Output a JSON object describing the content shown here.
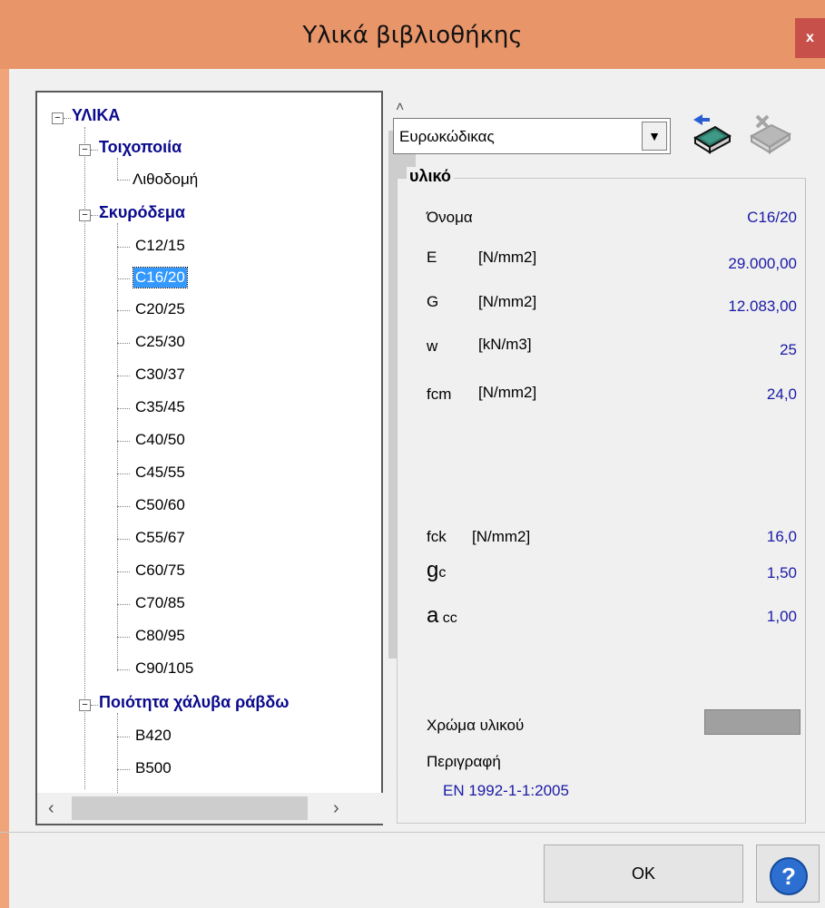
{
  "window": {
    "title": "Υλικά βιβλιοθήκης",
    "close_label": "x"
  },
  "tree": {
    "root": "ΥΛΙΚΑ",
    "groups": [
      {
        "label": "Τοιχοποιία",
        "items": [
          "Λιθοδομή"
        ]
      },
      {
        "label": "Σκυρόδεμα",
        "items": [
          "C12/15",
          "C16/20",
          "C20/25",
          "C25/30",
          "C30/37",
          "C35/45",
          "C40/50",
          "C45/55",
          "C50/60",
          "C55/67",
          "C60/75",
          "C70/85",
          "C80/95",
          "C90/105"
        ]
      },
      {
        "label": "Ποιότητα χάλυβα ράβδω",
        "items": [
          "B420",
          "B500"
        ]
      }
    ],
    "selected": "C16/20"
  },
  "standard": {
    "selected": "Ευρωκώδικας"
  },
  "material": {
    "group_title": "υλικό",
    "name_label": "Όνομα",
    "name_value": "C16/20",
    "E_label": "E",
    "E_unit": "[N/mm2]",
    "E_value": "29.000,00",
    "G_label": "G",
    "G_unit": "[N/mm2]",
    "G_value": "12.083,00",
    "w_label": "w",
    "w_unit": "[kN/m3]",
    "w_value": "25",
    "fcm_label": "fcm",
    "fcm_unit": "[N/mm2]",
    "fcm_value": "24,0",
    "fck_label": "fck",
    "fck_unit": "[N/mm2]",
    "fck_value": "16,0",
    "gc_label_main": "g",
    "gc_label_sub": "c",
    "gc_value": "1,50",
    "acc_label_main": "a",
    "acc_label_sub": " cc",
    "acc_value": "1,00",
    "color_label": "Χρώμα υλικού",
    "color_value": "#a0a0a0",
    "description_label": "Περιγραφή",
    "description_value": "EN 1992-1-1:2005"
  },
  "buttons": {
    "ok": "OK",
    "help": "?"
  }
}
